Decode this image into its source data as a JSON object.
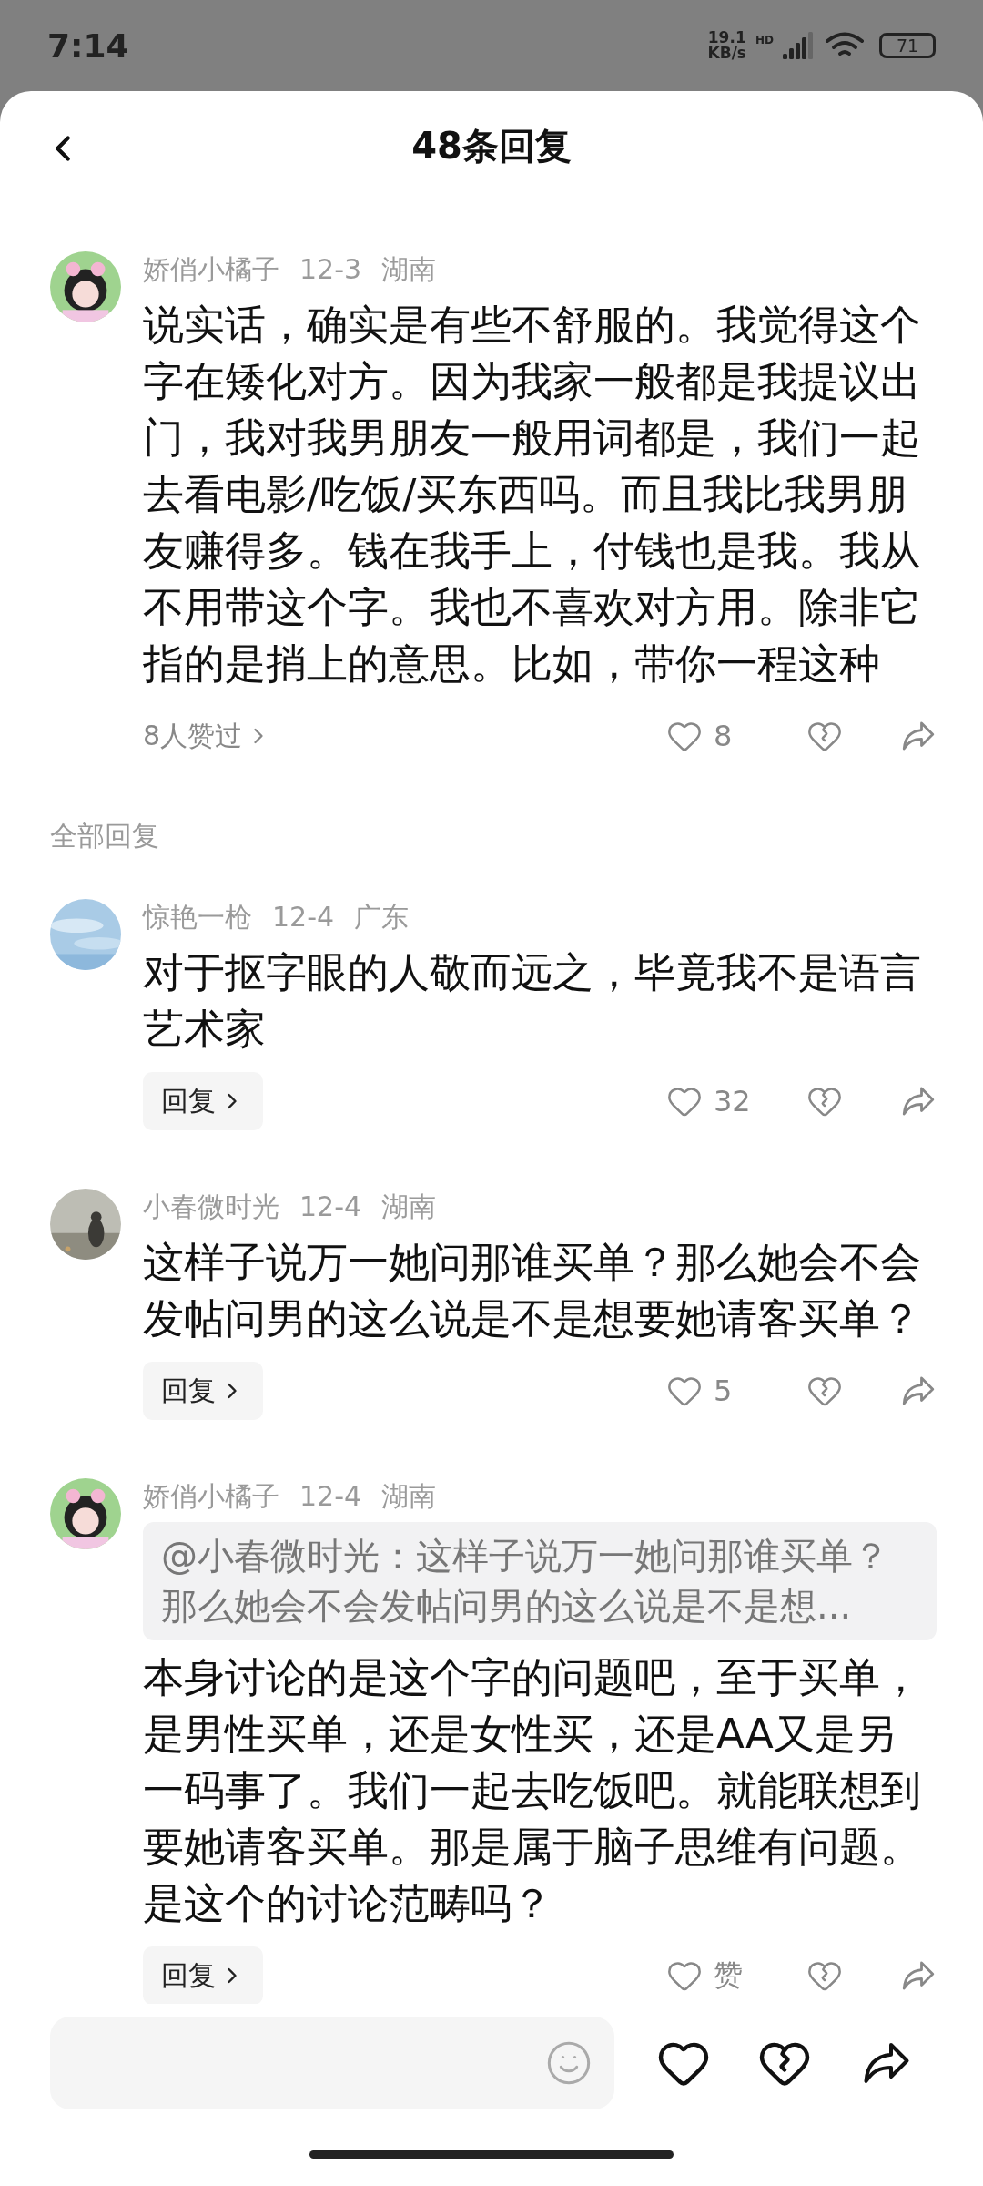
{
  "status_bar": {
    "time": "7:14",
    "net_speed": "19.1",
    "net_unit": "KB/s",
    "network_badge": "HD",
    "battery": "71"
  },
  "header": {
    "title": "48条回复"
  },
  "parent_comment": {
    "name": "娇俏小橘子",
    "date": "12-3",
    "region": "湖南",
    "body": "说实话，确实是有些不舒服的。我觉得这个字在矮化对方。因为我家一般都是我提议出门，我对我男朋友一般用词都是，我们一起去看电影/吃饭/买东西吗。而且我比我男朋友赚得多。钱在我手上，付钱也是我。我从不用带这个字。我也不喜欢对方用。除非它指的是捎上的意思。比如，带你一程这种",
    "likers": "8人赞过",
    "likes": "8"
  },
  "section_label": "全部回复",
  "replies": [
    {
      "name": "惊艳一枪",
      "date": "12-4",
      "region": "广东",
      "body": "对于抠字眼的人敬而远之，毕竟我不是语言艺术家",
      "reply_button": "回复",
      "likes": "32"
    },
    {
      "name": "小春微时光",
      "date": "12-4",
      "region": "湖南",
      "body": "这样子说万一她问那谁买单？那么她会不会发帖问男的这么说是不是想要她请客买单？",
      "reply_button": "回复",
      "likes": "5"
    },
    {
      "name": "娇俏小橘子",
      "date": "12-4",
      "region": "湖南",
      "quote": "@小春微时光：这样子说万一她问那谁买单？那么她会不会发帖问男的这么说是不是想...",
      "body": "本身讨论的是这个字的问题吧，至于买单，是男性买单，还是女性买，还是AA又是另一码事了。我们一起去吃饭吧。就能联想到要她请客买单。那是属于脑子思维有问题。是这个的讨论范畴吗？",
      "reply_button": "回复",
      "likes": "赞"
    }
  ]
}
